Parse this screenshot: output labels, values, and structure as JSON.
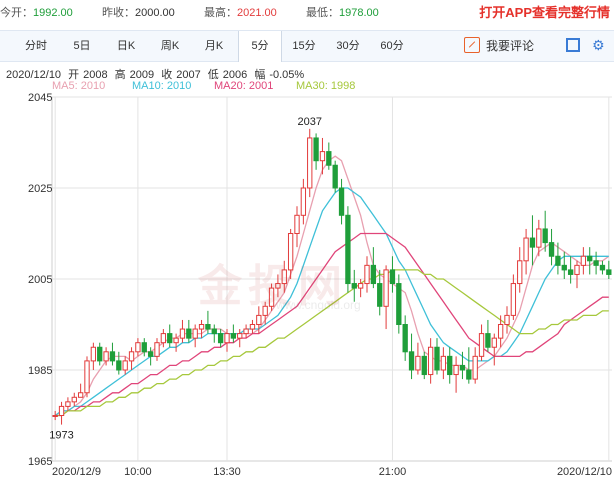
{
  "quote_bar": {
    "open_label": "今开：",
    "open_value": "1992.00",
    "prev_close_label": "昨收：",
    "prev_close_value": "2000.00",
    "high_label": "最高：",
    "high_value": "2021.00",
    "low_label": "最低：",
    "low_value": "1978.00",
    "promo_text": "打开APP查看完整行情"
  },
  "tabs": [
    "分时",
    "5日",
    "日K",
    "周K",
    "月K",
    "5分",
    "15分",
    "30分",
    "60分"
  ],
  "active_tab": "5分",
  "toolbar": {
    "comment_label": "我要评论",
    "comment_icon": "edit-icon",
    "fullscreen_icon": "fullscreen-icon",
    "settings_icon": "gear-icon"
  },
  "ohlc_line": {
    "date": "2020/12/10",
    "open_label": "开",
    "open": "2008",
    "high_label": "高",
    "high": "2009",
    "close_label": "收",
    "close": "2007",
    "low_label": "低",
    "low": "2006",
    "amp_label": "幅",
    "amp": "-0.05%"
  },
  "ma_legend": [
    {
      "text": "MA5: 2010",
      "color": "#e8a0b0"
    },
    {
      "text": "MA10: 2010",
      "color": "#3fc0d8"
    },
    {
      "text": "MA20: 2001",
      "color": "#e0457a"
    },
    {
      "text": "MA30: 1998",
      "color": "#a6c83c"
    }
  ],
  "watermark": {
    "main": "金投网",
    "sub": "www.cngold.org"
  },
  "colors": {
    "up": "#e23b3b",
    "down": "#1f9e3a",
    "grid": "#e3e3e3"
  },
  "chart_data": {
    "type": "candlestick",
    "ylim": [
      1965,
      2045
    ],
    "yticks": [
      2045,
      2025,
      2005,
      1985,
      1965
    ],
    "xticks": [
      {
        "label": "2020/12/9",
        "index": 0
      },
      {
        "label": "10:00",
        "index": 13
      },
      {
        "label": "13:30",
        "index": 27
      },
      {
        "label": "21:00",
        "index": 53
      },
      {
        "label": "2020/12/10",
        "index": 87
      }
    ],
    "annotations": [
      {
        "text": "2037",
        "index": 40,
        "value": 2038
      },
      {
        "text": "1973",
        "index": 1,
        "value": 1973
      }
    ],
    "candles": [
      [
        1975,
        1976,
        1974,
        1975
      ],
      [
        1975,
        1978,
        1973,
        1977
      ],
      [
        1977,
        1979,
        1976,
        1978
      ],
      [
        1978,
        1980,
        1977,
        1979
      ],
      [
        1979,
        1982,
        1979,
        1980
      ],
      [
        1980,
        1988,
        1979,
        1987
      ],
      [
        1987,
        1991,
        1985,
        1990
      ],
      [
        1990,
        1991,
        1986,
        1987
      ],
      [
        1987,
        1990,
        1986,
        1989
      ],
      [
        1989,
        1991,
        1986,
        1987
      ],
      [
        1987,
        1989,
        1984,
        1985
      ],
      [
        1985,
        1988,
        1984,
        1987
      ],
      [
        1987,
        1990,
        1985,
        1989
      ],
      [
        1989,
        1992,
        1988,
        1991
      ],
      [
        1991,
        1992,
        1988,
        1989
      ],
      [
        1989,
        1990,
        1986,
        1988
      ],
      [
        1988,
        1992,
        1987,
        1991
      ],
      [
        1991,
        1994,
        1990,
        1993
      ],
      [
        1993,
        1995,
        1990,
        1991
      ],
      [
        1991,
        1993,
        1989,
        1992
      ],
      [
        1992,
        1996,
        1991,
        1994
      ],
      [
        1994,
        1996,
        1991,
        1992
      ],
      [
        1992,
        1995,
        1990,
        1994
      ],
      [
        1994,
        1996,
        1992,
        1995
      ],
      [
        1995,
        1998,
        1993,
        1994
      ],
      [
        1994,
        1995,
        1991,
        1993
      ],
      [
        1993,
        1994,
        1990,
        1991
      ],
      [
        1991,
        1994,
        1989,
        1993
      ],
      [
        1993,
        1995,
        1991,
        1992
      ],
      [
        1992,
        1994,
        1990,
        1993
      ],
      [
        1993,
        1995,
        1992,
        1994
      ],
      [
        1994,
        1996,
        1993,
        1995
      ],
      [
        1995,
        1999,
        1993,
        1997
      ],
      [
        1997,
        2000,
        1995,
        1999
      ],
      [
        1999,
        2004,
        1998,
        2003
      ],
      [
        2003,
        2006,
        2001,
        2004
      ],
      [
        2004,
        2009,
        2002,
        2007
      ],
      [
        2007,
        2016,
        2005,
        2015
      ],
      [
        2015,
        2021,
        2012,
        2019
      ],
      [
        2019,
        2027,
        2017,
        2025
      ],
      [
        2025,
        2038,
        2023,
        2036
      ],
      [
        2036,
        2037,
        2029,
        2031
      ],
      [
        2031,
        2036,
        2028,
        2033
      ],
      [
        2033,
        2035,
        2029,
        2030
      ],
      [
        2030,
        2031,
        2024,
        2025
      ],
      [
        2025,
        2027,
        2017,
        2019
      ],
      [
        2019,
        2021,
        2002,
        2004
      ],
      [
        2004,
        2007,
        2000,
        2003
      ],
      [
        2003,
        2005,
        2001,
        2004
      ],
      [
        2004,
        2010,
        2002,
        2008
      ],
      [
        2008,
        2012,
        2003,
        2004
      ],
      [
        2004,
        2007,
        1997,
        1999
      ],
      [
        1999,
        2008,
        1994,
        2007
      ],
      [
        2007,
        2010,
        2002,
        2004
      ],
      [
        2004,
        2006,
        1993,
        1995
      ],
      [
        1995,
        1997,
        1987,
        1989
      ],
      [
        1989,
        1993,
        1983,
        1985
      ],
      [
        1985,
        1991,
        1984,
        1988
      ],
      [
        1988,
        1989,
        1983,
        1984
      ],
      [
        1984,
        1992,
        1982,
        1990
      ],
      [
        1990,
        1992,
        1984,
        1985
      ],
      [
        1985,
        1990,
        1983,
        1988
      ],
      [
        1988,
        1990,
        1982,
        1984
      ],
      [
        1984,
        1988,
        1980,
        1986
      ],
      [
        1986,
        1989,
        1983,
        1985
      ],
      [
        1985,
        1990,
        1982,
        1983
      ],
      [
        1983,
        1990,
        1982,
        1988
      ],
      [
        1988,
        1995,
        1987,
        1993
      ],
      [
        1993,
        1996,
        1989,
        1990
      ],
      [
        1990,
        1993,
        1986,
        1992
      ],
      [
        1992,
        1997,
        1990,
        1995
      ],
      [
        1995,
        1999,
        1993,
        1997
      ],
      [
        1997,
        2006,
        1996,
        2004
      ],
      [
        2004,
        2012,
        2002,
        2009
      ],
      [
        2009,
        2016,
        2006,
        2014
      ],
      [
        2014,
        2019,
        2008,
        2012
      ],
      [
        2012,
        2018,
        2010,
        2016
      ],
      [
        2016,
        2020,
        2011,
        2013
      ],
      [
        2013,
        2016,
        2008,
        2010
      ],
      [
        2010,
        2013,
        2006,
        2008
      ],
      [
        2008,
        2011,
        2005,
        2007
      ],
      [
        2007,
        2010,
        2004,
        2006
      ],
      [
        2006,
        2009,
        2003,
        2008
      ],
      [
        2008,
        2012,
        2006,
        2010
      ],
      [
        2010,
        2012,
        2006,
        2009
      ],
      [
        2009,
        2011,
        2006,
        2008
      ],
      [
        2008,
        2009,
        2006,
        2007
      ],
      [
        2007,
        2009,
        2005,
        2006
      ]
    ],
    "ma": [
      {
        "name": "MA5",
        "color": "#e8a0b0",
        "values": [
          1975,
          1976,
          1976,
          1977,
          1978,
          1980,
          1983,
          1985,
          1987,
          1988,
          1988,
          1988,
          1987,
          1988,
          1989,
          1989,
          1990,
          1991,
          1992,
          1992,
          1993,
          1993,
          1993,
          1993,
          1994,
          1994,
          1994,
          1993,
          1993,
          1993,
          1993,
          1993,
          1994,
          1996,
          1998,
          2000,
          2002,
          2006,
          2010,
          2015,
          2020,
          2025,
          2029,
          2031,
          2032,
          2031,
          2027,
          2023,
          2019,
          2013,
          2008,
          2006,
          2005,
          2004,
          2003,
          2002,
          1998,
          1993,
          1989,
          1988,
          1987,
          1987,
          1986,
          1986,
          1986,
          1985,
          1985,
          1986,
          1987,
          1988,
          1990,
          1992,
          1995,
          1998,
          2003,
          2008,
          2011,
          2012,
          2013,
          2012,
          2011,
          2010,
          2009,
          2008,
          2008,
          2009,
          2009,
          2010
        ]
      },
      {
        "name": "MA10",
        "color": "#3fc0d8",
        "values": [
          1975,
          1976,
          1976,
          1977,
          1977,
          1978,
          1979,
          1980,
          1981,
          1982,
          1983,
          1984,
          1985,
          1986,
          1987,
          1988,
          1988,
          1989,
          1990,
          1990,
          1991,
          1991,
          1992,
          1992,
          1993,
          1993,
          1993,
          1993,
          1993,
          1993,
          1994,
          1994,
          1994,
          1995,
          1996,
          1997,
          1999,
          2001,
          2004,
          2008,
          2012,
          2016,
          2020,
          2022,
          2024,
          2025,
          2025,
          2024,
          2023,
          2021,
          2019,
          2017,
          2015,
          2012,
          2009,
          2007,
          2004,
          2001,
          1998,
          1995,
          1993,
          1991,
          1990,
          1989,
          1988,
          1987,
          1987,
          1987,
          1987,
          1988,
          1988,
          1989,
          1991,
          1993,
          1996,
          1999,
          2002,
          2005,
          2007,
          2009,
          2010,
          2010,
          2010,
          2010,
          2010,
          2010,
          2010,
          2010
        ]
      },
      {
        "name": "MA20",
        "color": "#e0457a",
        "values": [
          1975,
          1975,
          1976,
          1976,
          1977,
          1977,
          1978,
          1978,
          1979,
          1980,
          1980,
          1981,
          1982,
          1982,
          1983,
          1984,
          1984,
          1985,
          1986,
          1986,
          1987,
          1987,
          1988,
          1989,
          1989,
          1990,
          1990,
          1991,
          1991,
          1992,
          1992,
          1993,
          1993,
          1994,
          1995,
          1996,
          1997,
          1998,
          1999,
          2001,
          2003,
          2005,
          2007,
          2009,
          2011,
          2012,
          2013,
          2014,
          2015,
          2015,
          2015,
          2015,
          2015,
          2014,
          2013,
          2012,
          2010,
          2008,
          2006,
          2004,
          2002,
          2000,
          1998,
          1996,
          1994,
          1992,
          1991,
          1990,
          1989,
          1988,
          1988,
          1988,
          1988,
          1988,
          1989,
          1989,
          1990,
          1991,
          1992,
          1993,
          1995,
          1996,
          1997,
          1998,
          1999,
          2000,
          2001,
          2001
        ]
      },
      {
        "name": "MA30",
        "color": "#a6c83c",
        "values": [
          1975,
          1975,
          1976,
          1976,
          1976,
          1977,
          1977,
          1977,
          1978,
          1978,
          1979,
          1979,
          1980,
          1980,
          1981,
          1981,
          1982,
          1982,
          1983,
          1983,
          1984,
          1984,
          1985,
          1985,
          1986,
          1986,
          1987,
          1987,
          1988,
          1988,
          1989,
          1989,
          1990,
          1990,
          1991,
          1992,
          1992,
          1993,
          1994,
          1995,
          1996,
          1997,
          1998,
          1999,
          2000,
          2001,
          2002,
          2003,
          2004,
          2005,
          2005,
          2006,
          2006,
          2007,
          2007,
          2007,
          2007,
          2007,
          2006,
          2006,
          2005,
          2005,
          2004,
          2003,
          2002,
          2001,
          2000,
          1999,
          1998,
          1997,
          1996,
          1995,
          1994,
          1993,
          1993,
          1993,
          1994,
          1994,
          1995,
          1995,
          1996,
          1996,
          1996,
          1997,
          1997,
          1997,
          1998,
          1998
        ]
      }
    ]
  }
}
